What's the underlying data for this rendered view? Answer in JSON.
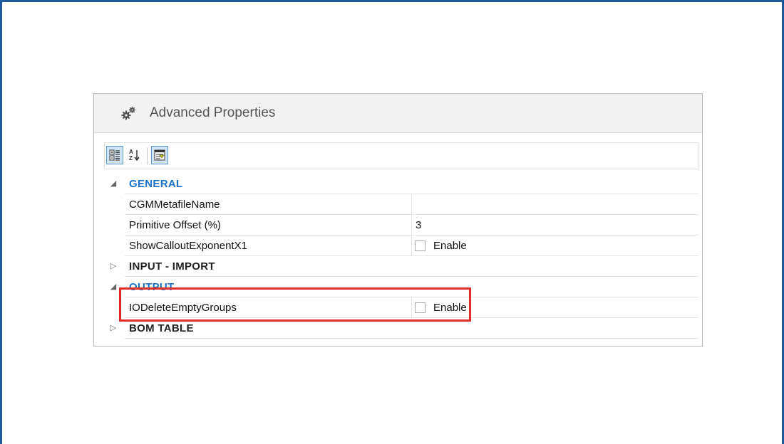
{
  "panel": {
    "title": "Advanced Properties",
    "icon": "gears-icon"
  },
  "toolbar": {
    "buttons": [
      {
        "name": "categorized-view-button",
        "active": true
      },
      {
        "name": "alphabetical-sort-button",
        "active": false
      },
      {
        "name": "property-pages-button",
        "active": true
      }
    ]
  },
  "categories": {
    "general": {
      "label": "GENERAL",
      "expanded": true,
      "properties": {
        "cgm": {
          "name": "CGMMetafileName",
          "value": ""
        },
        "offset": {
          "name": "Primitive Offset (%)",
          "value": "3"
        },
        "callout": {
          "name": "ShowCalloutExponentX1",
          "checkbox_label": "Enable",
          "checked": false
        }
      }
    },
    "input_import": {
      "label": "INPUT - IMPORT",
      "expanded": false
    },
    "output": {
      "label": "OUTPUT",
      "expanded": true,
      "properties": {
        "io_delete": {
          "name": "IODeleteEmptyGroups",
          "checkbox_label": "Enable",
          "checked": false
        }
      }
    },
    "bom_table": {
      "label": "BOM TABLE",
      "expanded": false
    }
  },
  "annotation": {
    "highlight_color": "#e02b2b"
  }
}
